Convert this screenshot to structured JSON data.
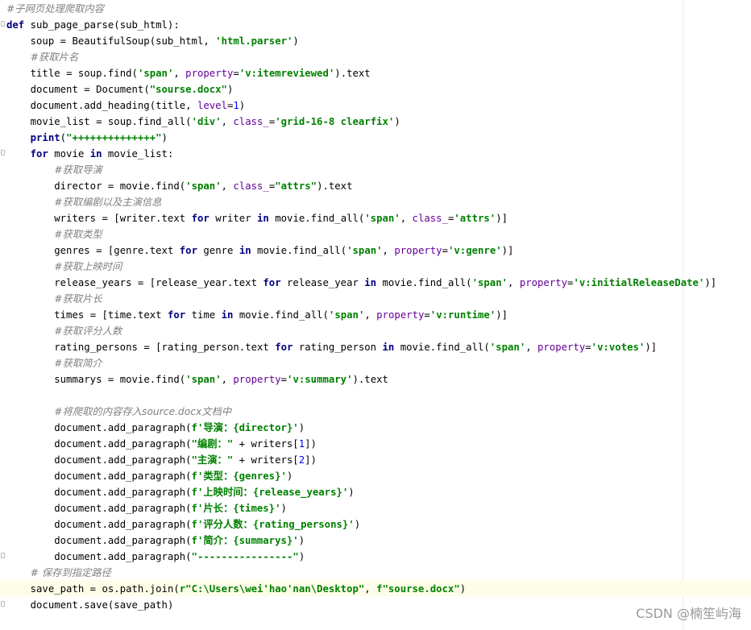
{
  "editor": {
    "lines": [
      "#子网页处理爬取内容",
      "def sub_page_parse(sub_html):",
      "    soup = BeautifulSoup(sub_html, 'html.parser')",
      "    #获取片名",
      "    title = soup.find('span', property='v:itemreviewed').text",
      "    document = Document(\"sourse.docx\")",
      "    document.add_heading(title, level=1)",
      "    movie_list = soup.find_all('div', class_='grid-16-8 clearfix')",
      "    print(\"++++++++++++++\")",
      "    for movie in movie_list:",
      "        #获取导演",
      "        director = movie.find('span', class_=\"attrs\").text",
      "        #获取编剧以及主演信息",
      "        writers = [writer.text for writer in movie.find_all('span', class_='attrs')]",
      "        #获取类型",
      "        genres = [genre.text for genre in movie.find_all('span', property='v:genre')]",
      "        #获取上映时间",
      "        release_years = [release_year.text for release_year in movie.find_all('span', property='v:initialReleaseDate')]",
      "        #获取片长",
      "        times = [time.text for time in movie.find_all('span', property='v:runtime')]",
      "        #获取评分人数",
      "        rating_persons = [rating_person.text for rating_person in movie.find_all('span', property='v:votes')]",
      "        #获取简介",
      "        summarys = movie.find('span', property='v:summary').text",
      "",
      "        #将爬取的内容存入source.docx文档中",
      "        document.add_paragraph(f'导演：{director}')",
      "        document.add_paragraph(\"编剧：\" + writers[1])",
      "        document.add_paragraph(\"主演：\" + writers[2])",
      "        document.add_paragraph(f'类型：{genres}')",
      "        document.add_paragraph(f'上映时间：{release_years}')",
      "        document.add_paragraph(f'片长：{times}')",
      "        document.add_paragraph(f'评分人数：{rating_persons}')",
      "        document.add_paragraph(f'简介：{summarys}')",
      "        document.add_paragraph(\"----------------\")",
      "    # 保存到指定路径",
      "    save_path = os.path.join(r\"C:\\Users\\wei'hao'nan\\Desktop\", f\"sourse.docx\")",
      "    document.save(save_path)"
    ]
  },
  "watermark": "CSDN @楠笙屿海",
  "colors": {
    "keyword": "#000080",
    "string": "#008000",
    "keyword_argument": "#660099",
    "number": "#0000ff",
    "comment": "#808080",
    "current_line": "#fdfde8"
  }
}
